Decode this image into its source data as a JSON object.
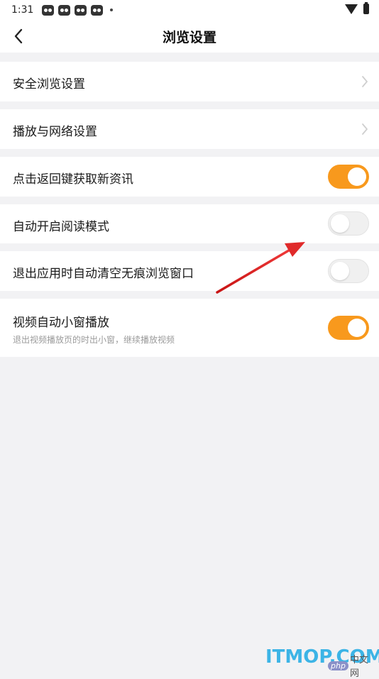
{
  "status_bar": {
    "time": "1:31",
    "notification_icons": [
      "notification-icon",
      "notification-icon",
      "notification-icon",
      "notification-icon"
    ],
    "wifi_icon": "wifi-icon",
    "battery_icon": "battery-icon"
  },
  "header": {
    "title": "浏览设置",
    "back_icon": "back-arrow-icon"
  },
  "settings": [
    {
      "label": "安全浏览设置",
      "type": "chevron"
    },
    {
      "label": "播放与网络设置",
      "type": "chevron"
    },
    {
      "label": "点击返回键获取新资讯",
      "type": "toggle",
      "on": true
    },
    {
      "label": "自动开启阅读模式",
      "type": "toggle",
      "on": false
    },
    {
      "label": "退出应用时自动清空无痕浏览窗口",
      "type": "toggle",
      "on": false
    },
    {
      "label": "视频自动小窗播放",
      "sublabel": "退出视频播放页的时出小窗，继续播放视频",
      "type": "toggle",
      "on": true
    }
  ],
  "colors": {
    "accent": "#f8991d",
    "background": "#f2f2f4",
    "annotation_arrow": "#e02a2a"
  },
  "watermark": {
    "text": "ITMOP.COM",
    "php_badge": "php",
    "cn_text": "中文网"
  }
}
